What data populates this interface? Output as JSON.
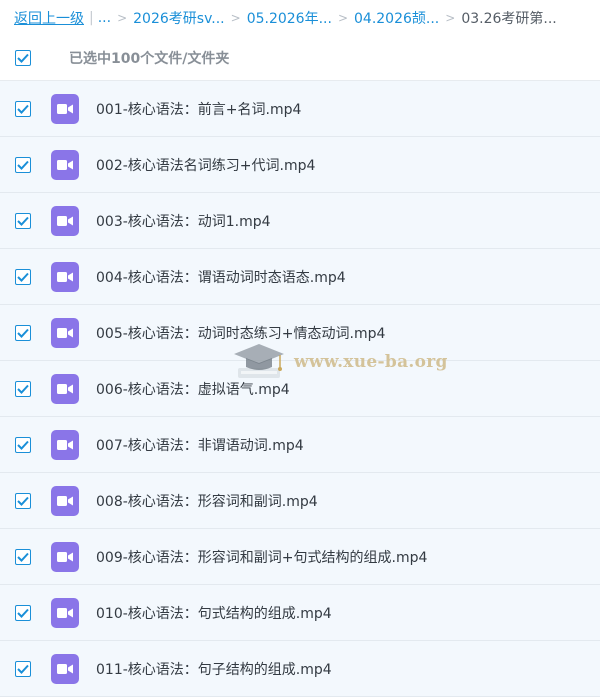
{
  "breadcrumb": {
    "back_label": "返回上一级",
    "pipe": "|",
    "ellipsis": "...",
    "separator": ">",
    "items": [
      "2026考研sv...",
      "05.2026年...",
      "04.2026颉..."
    ],
    "current": "03.26考研第..."
  },
  "selection": {
    "label": "已选中100个文件/文件夹",
    "all_checked": true
  },
  "files": [
    {
      "name": "001-核心语法：前言+名词.mp4",
      "checked": true
    },
    {
      "name": "002-核心语法名词练习+代词.mp4",
      "checked": true
    },
    {
      "name": "003-核心语法：动词1.mp4",
      "checked": true
    },
    {
      "name": "004-核心语法：谓语动词时态语态.mp4",
      "checked": true
    },
    {
      "name": "005-核心语法：动词时态练习+情态动词.mp4",
      "checked": true
    },
    {
      "name": "006-核心语法：虚拟语气.mp4",
      "checked": true
    },
    {
      "name": "007-核心语法：非谓语动词.mp4",
      "checked": true
    },
    {
      "name": "008-核心语法：形容词和副词.mp4",
      "checked": true
    },
    {
      "name": "009-核心语法：形容词和副词+句式结构的组成.mp4",
      "checked": true
    },
    {
      "name": "010-核心语法：句式结构的组成.mp4",
      "checked": true
    },
    {
      "name": "011-核心语法：句子结构的组成.mp4",
      "checked": true
    }
  ],
  "watermark": "www.xue-ba.org",
  "colors": {
    "accent": "#1a8fd8",
    "row_bg": "#f3f8fd",
    "video_icon": "#8a75e8"
  }
}
